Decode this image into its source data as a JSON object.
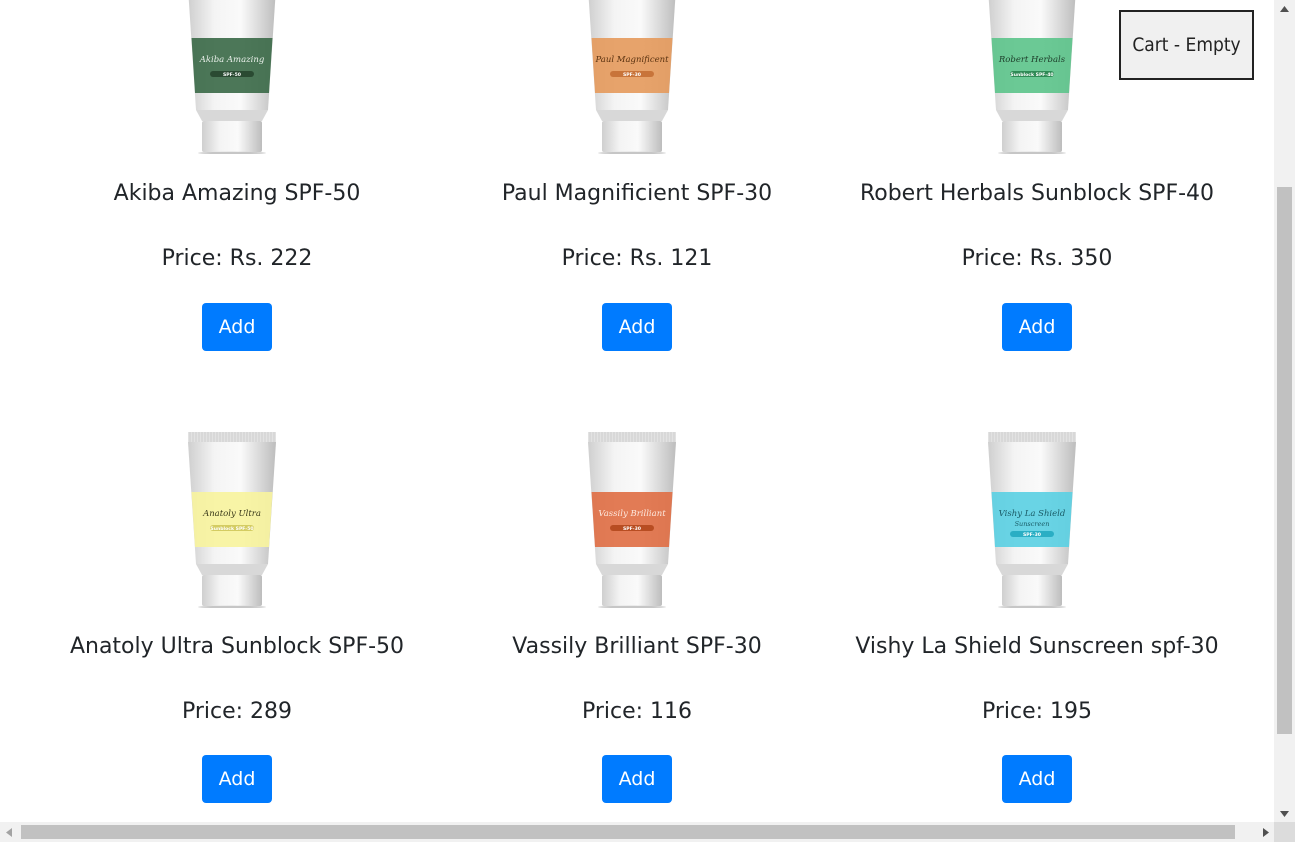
{
  "cart": {
    "label": "Cart - Empty"
  },
  "products": [
    {
      "name": "Akiba Amazing SPF-50",
      "price": "Price: Rs. 222",
      "add_label": "Add",
      "label_color": "#3d6b4a",
      "brand_text": "Akiba Amazing",
      "spf_text": "SPF-50",
      "text_color": "#e8efe9",
      "pill_color": "#2a4a32"
    },
    {
      "name": "Paul Magnificient SPF-30",
      "price": "Price: Rs. 121",
      "add_label": "Add",
      "label_color": "#e59b5e",
      "brand_text": "Paul Magnificent",
      "spf_text": "SPF-30",
      "text_color": "#5a3210",
      "pill_color": "#c8743a"
    },
    {
      "name": "Robert Herbals Sunblock SPF-40",
      "price": "Price: Rs. 350",
      "add_label": "Add",
      "label_color": "#5ec48c",
      "brand_text": "Robert Herbals",
      "spf_text": "Sunblock SPF-40",
      "text_color": "#1d3d2a",
      "pill_color": "#2f8a55"
    },
    {
      "name": "Anatoly Ultra Sunblock SPF-50",
      "price": "Price: 289",
      "add_label": "Add",
      "label_color": "#f7f39e",
      "brand_text": "Anatoly Ultra",
      "spf_text": "Sunblock SPF-50",
      "text_color": "#3a3a1a",
      "pill_color": "#d4cc62"
    },
    {
      "name": "Vassily Brilliant SPF-30",
      "price": "Price: 116",
      "add_label": "Add",
      "label_color": "#e07046",
      "brand_text": "Vassily Brilliant",
      "spf_text": "SPF-30",
      "text_color": "#fde8de",
      "pill_color": "#b84d22"
    },
    {
      "name": "Vishy La Shield Sunscreen spf-30",
      "price": "Price: 195",
      "add_label": "Add",
      "label_color": "#5cd0e3",
      "brand_text": "Vishy La Shield",
      "spf_text": "SPF-30",
      "text_color": "#1a5b66",
      "pill_color": "#2aaec4",
      "sub_text": "Sunscreen"
    }
  ],
  "icons": {
    "scroll_up": "triangle-up-icon",
    "scroll_down": "triangle-down-icon",
    "scroll_left": "triangle-left-icon",
    "scroll_right": "triangle-right-icon"
  },
  "colors": {
    "accent": "#007bff"
  }
}
